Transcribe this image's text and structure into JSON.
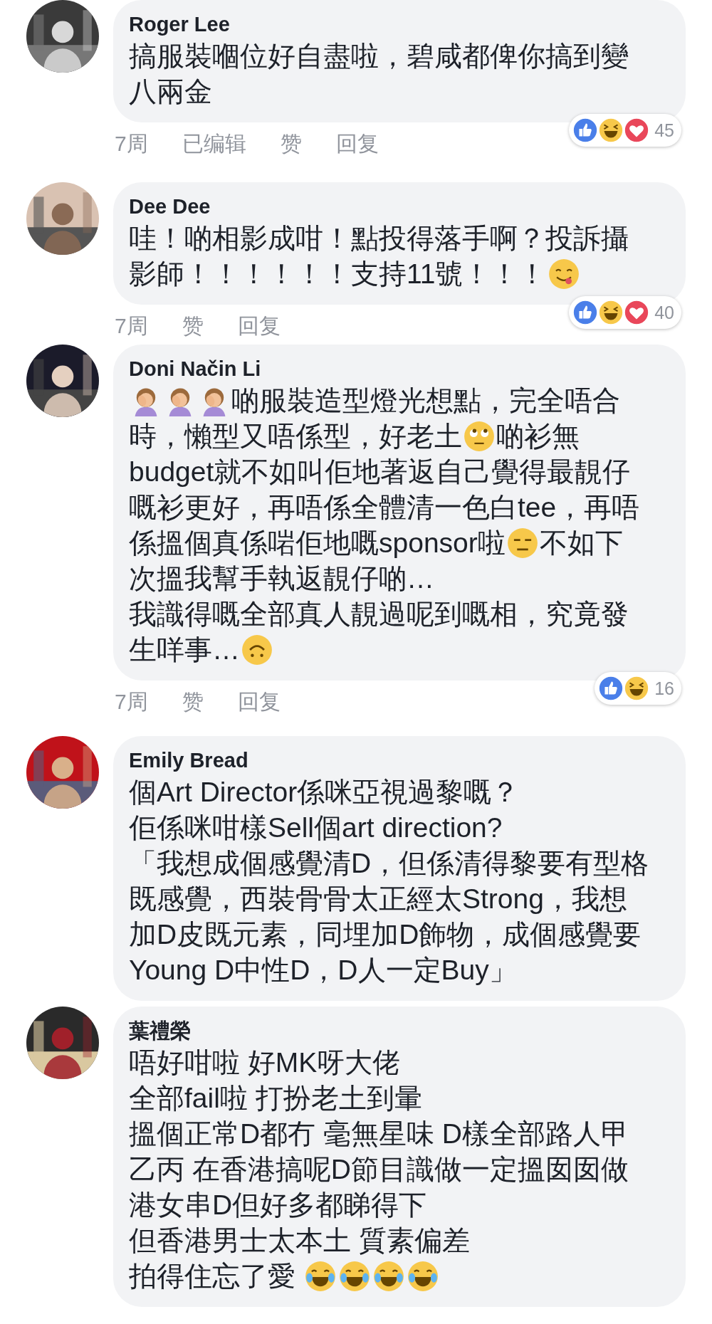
{
  "comments": [
    {
      "name": "Roger Lee",
      "lines": [
        [
          {
            "kind": "text",
            "text": "搞服裝嗰位好自盡啦，碧咸都俾你搞到變"
          }
        ],
        [
          {
            "kind": "text",
            "text": "八兩金"
          }
        ]
      ],
      "meta": [
        "7周",
        "已编辑",
        "赞",
        "回复"
      ],
      "reactions": [
        {
          "kind": "like"
        },
        {
          "kind": "haha"
        },
        {
          "kind": "love"
        }
      ],
      "reaction_count": "45"
    },
    {
      "name": "Dee Dee",
      "lines": [
        [
          {
            "kind": "text",
            "text": "哇！啲相影成咁！點投得落手啊？投訴攝"
          }
        ],
        [
          {
            "kind": "text",
            "text": "影師！！！！！！支持11號！！！"
          },
          {
            "kind": "yum"
          }
        ]
      ],
      "meta": [
        "7周",
        "赞",
        "回复"
      ],
      "reactions": [
        {
          "kind": "like"
        },
        {
          "kind": "haha"
        },
        {
          "kind": "love"
        }
      ],
      "reaction_count": "40"
    },
    {
      "name": "Doni Način Li",
      "lines": [
        [
          {
            "kind": "facepalm"
          },
          {
            "kind": "facepalm"
          },
          {
            "kind": "facepalm"
          },
          {
            "kind": "text",
            "text": "啲服裝造型燈光想點，完全唔合"
          }
        ],
        [
          {
            "kind": "text",
            "text": "時，懶型又唔係型，好老土"
          },
          {
            "kind": "eyeroll"
          },
          {
            "kind": "text",
            "text": "啲衫無"
          }
        ],
        [
          {
            "kind": "text",
            "text": "budget就不如叫佢地著返自己覺得最靚仔"
          }
        ],
        [
          {
            "kind": "text",
            "text": "嘅衫更好，再唔係全體清一色白tee，再唔"
          }
        ],
        [
          {
            "kind": "text",
            "text": "係搵個真係啱佢地嘅sponsor啦"
          },
          {
            "kind": "unamused"
          },
          {
            "kind": "text",
            "text": "不如下"
          }
        ],
        [
          {
            "kind": "text",
            "text": "次搵我幫手執返靚仔啲…"
          }
        ],
        [
          {
            "kind": "text",
            "text": "我識得嘅全部真人靚過呢到嘅相，究竟發"
          }
        ],
        [
          {
            "kind": "text",
            "text": "生咩事…"
          },
          {
            "kind": "upsidedown"
          }
        ]
      ],
      "meta": [
        "7周",
        "赞",
        "回复"
      ],
      "reactions": [
        {
          "kind": "like"
        },
        {
          "kind": "haha"
        }
      ],
      "reaction_count": "16"
    },
    {
      "name": "Emily Bread",
      "lines": [
        [
          {
            "kind": "text",
            "text": "個Art Director係咪亞視過黎嘅？"
          }
        ],
        [
          {
            "kind": "text",
            "text": "佢係咪咁樣Sell個art direction?"
          }
        ],
        [
          {
            "kind": "text",
            "text": "「我想成個感覺清D，但係清得黎要有型格"
          }
        ],
        [
          {
            "kind": "text",
            "text": "既感覺，西裝骨骨太正經太Strong，我想"
          }
        ],
        [
          {
            "kind": "text",
            "text": "加D皮既元素，同埋加D飾物，成個感覺要"
          }
        ],
        [
          {
            "kind": "text",
            "text": "Young D中性D，D人一定Buy」"
          }
        ]
      ]
    },
    {
      "name": "葉禮榮",
      "lines": [
        [
          {
            "kind": "text",
            "text": "唔好咁啦 好MK呀大佬"
          }
        ],
        [
          {
            "kind": "text",
            "text": "全部fail啦 打扮老土到暈"
          }
        ],
        [
          {
            "kind": "text",
            "text": "搵個正常D都冇 毫無星味 D樣全部路人甲"
          }
        ],
        [
          {
            "kind": "text",
            "text": "乙丙 在香港搞呢D節目識做一定搵囡囡做"
          }
        ],
        [
          {
            "kind": "text",
            "text": "港女串D但好多都睇得下"
          }
        ],
        [
          {
            "kind": "text",
            "text": "但香港男士太本土 質素偏差"
          }
        ],
        [
          {
            "kind": "text",
            "text": "拍得住忘了愛 "
          },
          {
            "kind": "joy"
          },
          {
            "kind": "joy"
          },
          {
            "kind": "joy"
          },
          {
            "kind": "joy"
          }
        ]
      ]
    }
  ]
}
